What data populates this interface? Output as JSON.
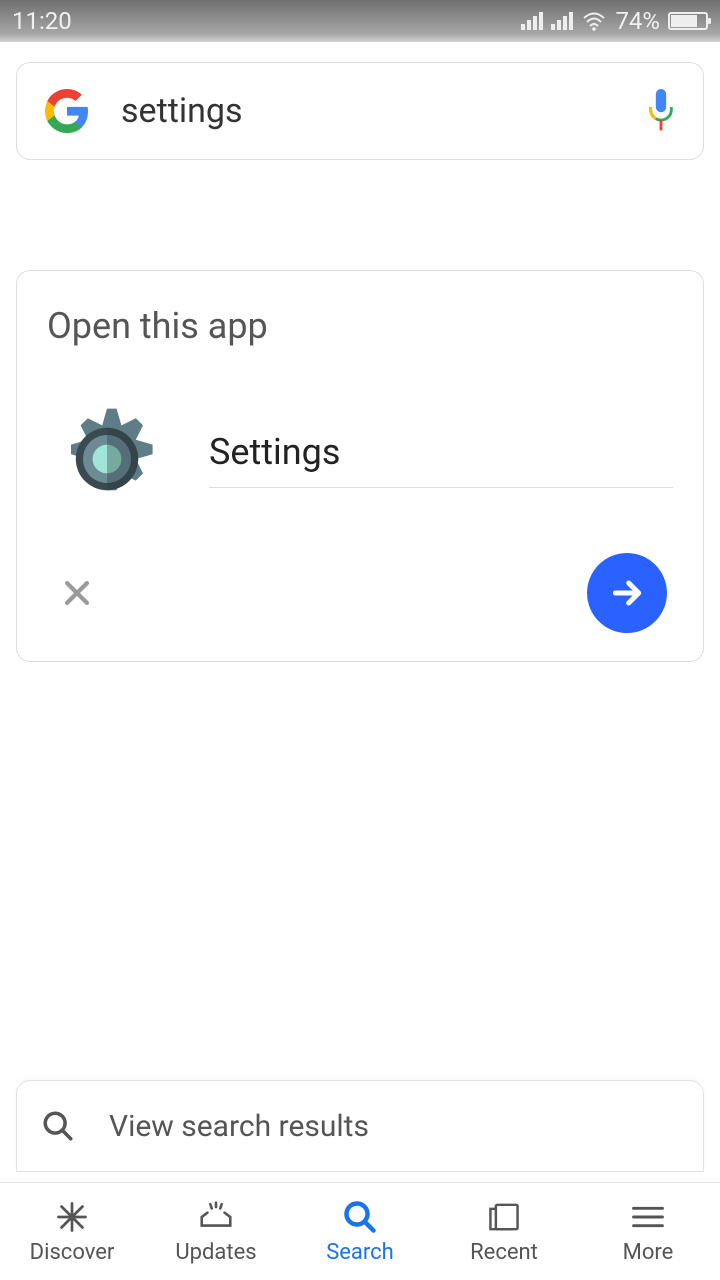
{
  "status": {
    "time": "11:20",
    "battery_pct": "74%"
  },
  "search": {
    "query": "settings"
  },
  "card": {
    "title": "Open this app",
    "app_name": "Settings"
  },
  "results": {
    "label": "View search results"
  },
  "nav": {
    "discover": "Discover",
    "updates": "Updates",
    "search": "Search",
    "recent": "Recent",
    "more": "More"
  }
}
